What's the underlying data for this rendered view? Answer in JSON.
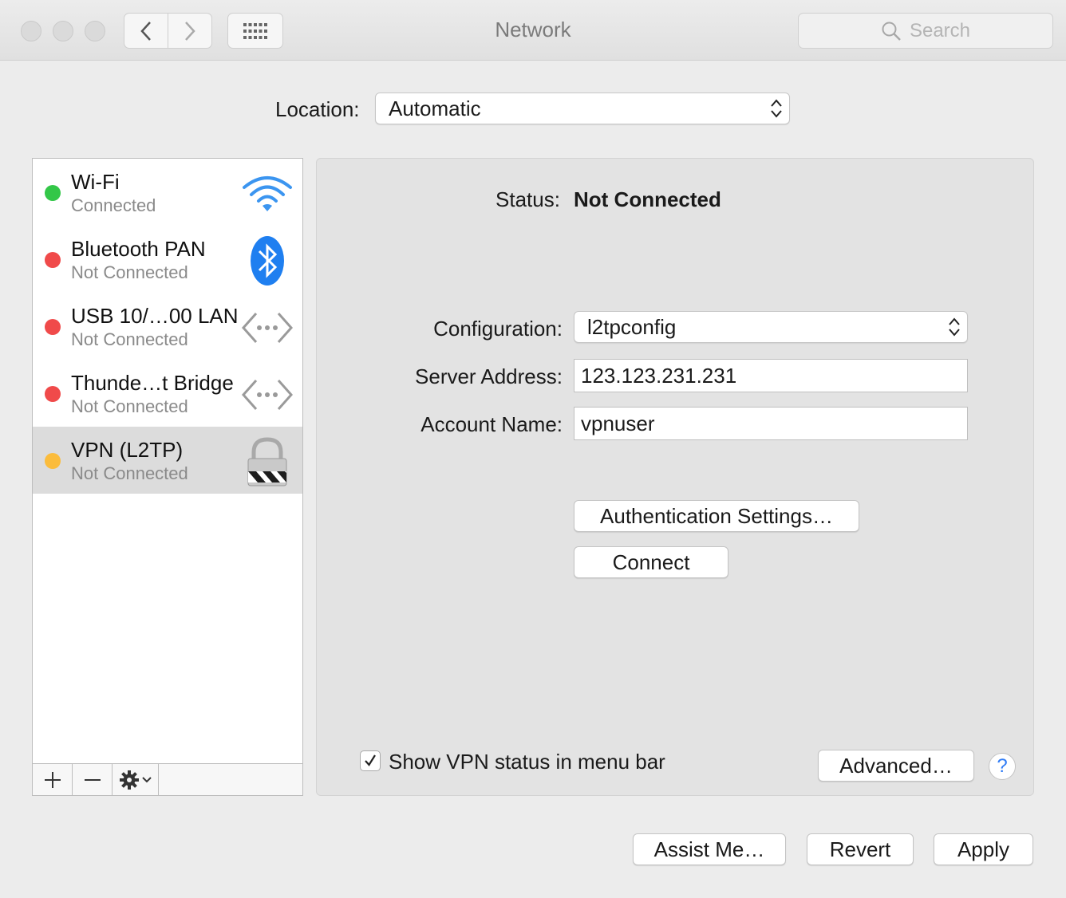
{
  "window": {
    "title": "Network"
  },
  "toolbar": {
    "search_placeholder": "Search"
  },
  "location": {
    "label": "Location:",
    "value": "Automatic"
  },
  "services": [
    {
      "name": "Wi-Fi",
      "status": "Connected",
      "dot_color": "#33c748",
      "icon": "wifi-icon"
    },
    {
      "name": "Bluetooth PAN",
      "status": "Not Connected",
      "dot_color": "#f04a4a",
      "icon": "bluetooth-icon"
    },
    {
      "name": "USB 10/…00 LAN",
      "status": "Not Connected",
      "dot_color": "#f04a4a",
      "icon": "ethernet-icon"
    },
    {
      "name": "Thunde…t Bridge",
      "status": "Not Connected",
      "dot_color": "#f04a4a",
      "icon": "ethernet-icon"
    },
    {
      "name": "VPN (L2TP)",
      "status": "Not Connected",
      "dot_color": "#fbbc3c",
      "icon": "vpn-lock-icon",
      "selected": true
    }
  ],
  "detail": {
    "status_label": "Status:",
    "status_value": "Not Connected",
    "configuration_label": "Configuration:",
    "configuration_value": "l2tpconfig",
    "server_label": "Server Address:",
    "server_value": "123.123.231.231",
    "account_label": "Account Name:",
    "account_value": "vpnuser",
    "auth_button": "Authentication Settings…",
    "connect_button": "Connect",
    "show_status_label": "Show VPN status in menu bar",
    "show_status_checked": true,
    "advanced_button": "Advanced…",
    "help_label": "?"
  },
  "footer": {
    "assist_button": "Assist Me…",
    "revert_button": "Revert",
    "apply_button": "Apply"
  }
}
